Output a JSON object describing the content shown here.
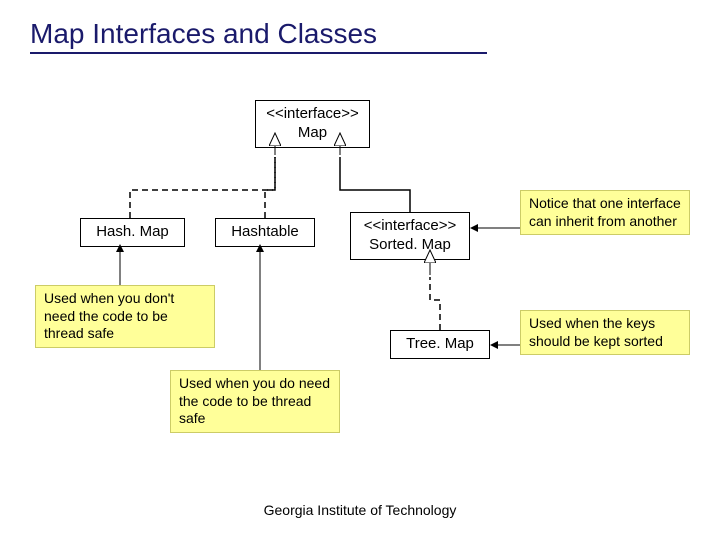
{
  "title": "Map Interfaces and Classes",
  "boxes": {
    "map": {
      "stereotype": "<<interface>>",
      "name": "Map"
    },
    "hashmap": {
      "name": "Hash. Map"
    },
    "hashtable": {
      "name": "Hashtable"
    },
    "sortedmap": {
      "stereotype": "<<interface>>",
      "name": "Sorted. Map"
    },
    "treemap": {
      "name": "Tree. Map"
    }
  },
  "notes": {
    "inherit": "Notice that one interface can inherit from another",
    "hashmap_note": "Used when you don't need the code to be thread safe",
    "hashtable_note": "Used when you do need the code to be thread safe",
    "treemap_note": "Used when the keys should be kept sorted"
  },
  "footer": "Georgia Institute of Technology"
}
